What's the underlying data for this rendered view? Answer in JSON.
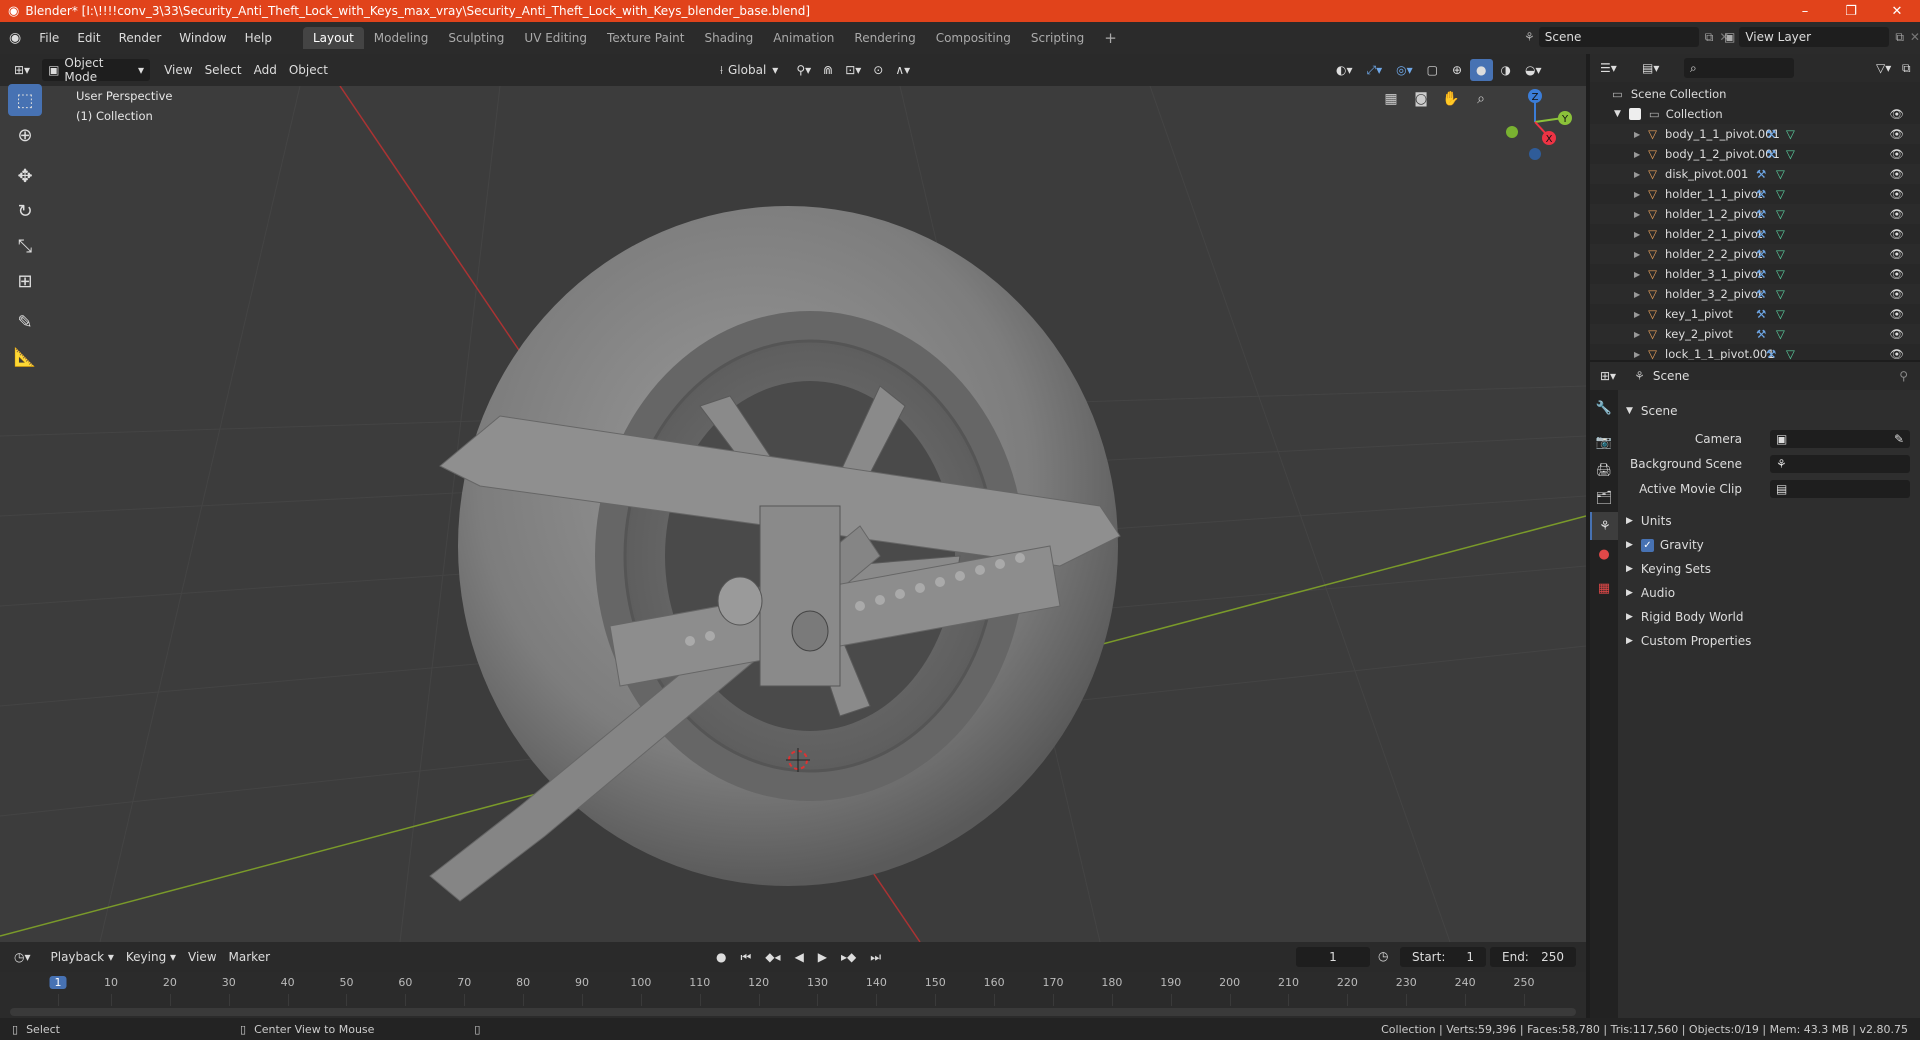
{
  "titlebar": {
    "title": "Blender* [I:\\!!!!conv_3\\33\\Security_Anti_Theft_Lock_with_Keys_max_vray\\Security_Anti_Theft_Lock_with_Keys_blender_base.blend]",
    "minimize": "–",
    "restore": "❐",
    "close": "✕"
  },
  "menu": {
    "file": "File",
    "edit": "Edit",
    "render": "Render",
    "window": "Window",
    "help": "Help"
  },
  "workspaces": [
    "Layout",
    "Modeling",
    "Sculpting",
    "UV Editing",
    "Texture Paint",
    "Shading",
    "Animation",
    "Rendering",
    "Compositing",
    "Scripting"
  ],
  "add_workspace": "+",
  "scene_field": "Scene",
  "viewlayer_field": "View Layer",
  "viewport_header": {
    "mode": "Object Mode",
    "view": "View",
    "select": "Select",
    "add": "Add",
    "object": "Object",
    "orientation": "Global"
  },
  "viewport": {
    "perspective": "User Perspective",
    "collection": "(1) Collection"
  },
  "gizmo": {
    "x": "X",
    "y": "Y",
    "z": "Z"
  },
  "timeline": {
    "playback": "Playback",
    "keying": "Keying",
    "view": "View",
    "marker": "Marker",
    "current_frame": "1",
    "start_label": "Start:",
    "start": "1",
    "end_label": "End:",
    "end": "250",
    "ticks": [
      "1",
      "10",
      "20",
      "30",
      "40",
      "50",
      "60",
      "70",
      "80",
      "90",
      "100",
      "110",
      "120",
      "130",
      "140",
      "150",
      "160",
      "170",
      "180",
      "190",
      "200",
      "210",
      "220",
      "230",
      "240",
      "250"
    ]
  },
  "outliner": {
    "root": "Scene Collection",
    "collection": "Collection",
    "items": [
      "body_1_1_pivot.001",
      "body_1_2_pivot.001",
      "disk_pivot.001",
      "holder_1_1_pivot",
      "holder_1_2_pivot",
      "holder_2_1_pivot",
      "holder_2_2_pivot",
      "holder_3_1_pivot",
      "holder_3_2_pivot",
      "key_1_pivot",
      "key_2_pivot",
      "lock_1_1_pivot.001"
    ]
  },
  "properties": {
    "header": "Scene",
    "panel": "Scene",
    "camera_label": "Camera",
    "background_label": "Background Scene",
    "movieclip_label": "Active Movie Clip",
    "sections": [
      "Units",
      "Gravity",
      "Keying Sets",
      "Audio",
      "Rigid Body World",
      "Custom Properties"
    ]
  },
  "status": {
    "select": "Select",
    "center": "Center View to Mouse",
    "stats": "Collection | Verts:59,396 | Faces:58,780 | Tris:117,560 | Objects:0/19 | Mem: 43.3 MB | v2.80.75"
  },
  "colors": {
    "titlebar": "#e1431b",
    "accent": "#4772b3",
    "object_orange": "#e8a15c",
    "modifier_blue": "#6fa8e8",
    "mesh_green": "#5bd0a0"
  }
}
